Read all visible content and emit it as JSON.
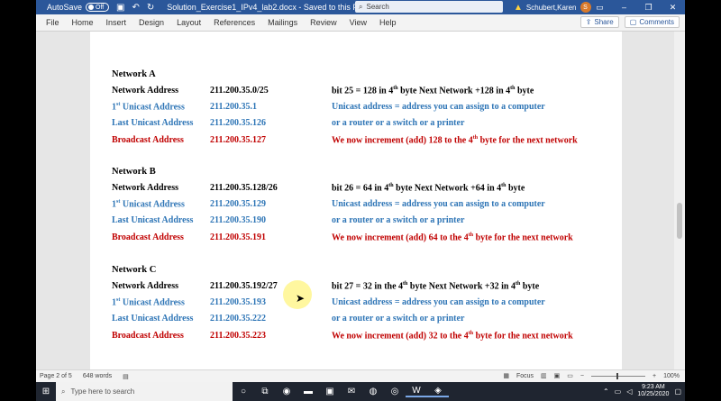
{
  "titlebar": {
    "autosave_label": "AutoSave",
    "autosave_state": "Off",
    "doc_title": "Solution_Exercise1_IPv4_lab2.docx  -  Saved to this PC",
    "search_placeholder": "Search",
    "user_name": "Schubert,Karen",
    "user_initial": "S"
  },
  "menubar": {
    "items": [
      "File",
      "Home",
      "Insert",
      "Design",
      "Layout",
      "References",
      "Mailings",
      "Review",
      "View",
      "Help"
    ],
    "share_label": "Share",
    "comments_label": "Comments"
  },
  "document": {
    "networks": [
      {
        "title": "Network A",
        "rows": [
          {
            "label": "Network Address",
            "value": "211.200.35.0/25",
            "note_parts": [
              "bit 25 = 128 in 4",
              "th",
              " byte    Next Network +128 in 4",
              "th",
              " byte"
            ],
            "color": "black"
          },
          {
            "label_parts": [
              "1",
              "st",
              " Unicast Address"
            ],
            "value": "211.200.35.1",
            "note": "Unicast address = address you can assign to a computer",
            "color": "blue"
          },
          {
            "label": "Last Unicast Address",
            "value": "211.200.35.126",
            "note": "or a router or a switch or a printer",
            "color": "blue"
          },
          {
            "label": "Broadcast Address",
            "value": "211.200.35.127",
            "note_parts": [
              "We now increment (add) 128 to the 4",
              "th",
              " byte for the next network"
            ],
            "color": "red"
          }
        ]
      },
      {
        "title": "Network B",
        "rows": [
          {
            "label": "Network Address",
            "value": "211.200.35.128/26",
            "note_parts": [
              "bit 26 = 64 in 4",
              "th",
              " byte    Next Network +64 in 4",
              "th",
              " byte"
            ],
            "color": "black"
          },
          {
            "label_parts": [
              "1",
              "st",
              " Unicast Address"
            ],
            "value": "211.200.35.129",
            "note": "Unicast address = address you can assign to a computer",
            "color": "blue"
          },
          {
            "label": "Last Unicast Address",
            "value": "211.200.35.190",
            "note": "or a router or a switch or a printer",
            "color": "blue"
          },
          {
            "label": "Broadcast Address",
            "value": "211.200.35.191",
            "note_parts": [
              "We now increment (add) 64 to the 4",
              "th",
              " byte for the next network"
            ],
            "color": "red"
          }
        ]
      },
      {
        "title": "Network C",
        "rows": [
          {
            "label": "Network Address",
            "value": "211.200.35.192/27",
            "note_parts": [
              "bit 27 = 32 in the 4",
              "th",
              " byte    Next Network +32 in 4",
              "th",
              " byte"
            ],
            "color": "black"
          },
          {
            "label_parts": [
              "1",
              "st",
              " Unicast Address"
            ],
            "value": "211.200.35.193",
            "note": "Unicast address = address you can assign to a computer",
            "color": "blue"
          },
          {
            "label": "Last Unicast Address",
            "value": "211.200.35.222",
            "note": "or a router or a switch or a printer",
            "color": "blue"
          },
          {
            "label": "Broadcast Address",
            "value": "211.200.35.223",
            "note_parts": [
              "We now increment (add) 32 to the 4",
              "th",
              " byte for the next network"
            ],
            "color": "red"
          }
        ]
      }
    ]
  },
  "statusbar": {
    "page": "Page 2 of 5",
    "words": "648 words",
    "focus_label": "Focus",
    "zoom": "100%"
  },
  "taskbar": {
    "search_placeholder": "Type here to search",
    "time": "9:23 AM",
    "date": "10/25/2020"
  },
  "colors": {
    "word_blue": "#2b579a",
    "text_blue": "#2e75b6",
    "text_red": "#c00000"
  }
}
